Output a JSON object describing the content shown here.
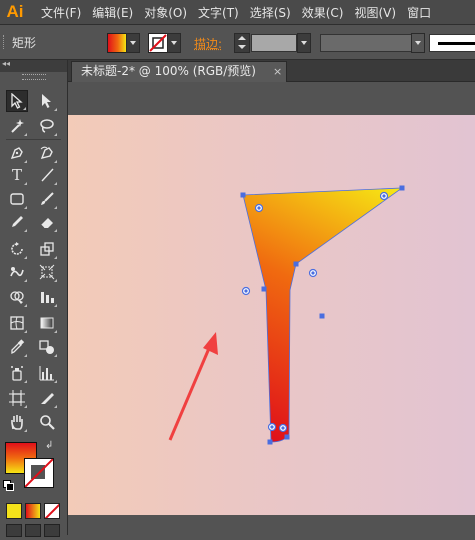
{
  "app": {
    "logo": "Ai"
  },
  "menu": [
    "文件(F)",
    "编辑(E)",
    "对象(O)",
    "文字(T)",
    "选择(S)",
    "效果(C)",
    "视图(V)",
    "窗口"
  ],
  "control_bar": {
    "selection_label": "矩形",
    "stroke_label": "描边",
    "stroke_colon": ":"
  },
  "document_tab": {
    "title": "未标题-2* @ 100% (RGB/预览)",
    "close": "×"
  },
  "colors": {
    "gradient_start": "#e0101a",
    "gradient_mid": "#f06a10",
    "gradient_end": "#f6e414",
    "accent_arrow": "#f04040",
    "anchor_blue": "#4a6ee0"
  },
  "tools": [
    "selection-tool",
    "direct-selection-tool",
    "magic-wand-tool",
    "lasso-tool",
    "pen-tool",
    "curvature-tool",
    "type-tool",
    "line-tool",
    "rectangle-tool",
    "paintbrush-tool",
    "pencil-tool",
    "eraser-tool",
    "rotate-tool",
    "scale-tool",
    "warp-tool",
    "free-transform-tool",
    "shape-builder-tool",
    "chart-tool",
    "mesh-tool",
    "gradient-tool",
    "eyedropper-tool",
    "blend-tool",
    "symbol-sprayer-tool",
    "column-graph-tool",
    "artboard-tool",
    "slice-tool",
    "hand-tool",
    "zoom-tool"
  ]
}
